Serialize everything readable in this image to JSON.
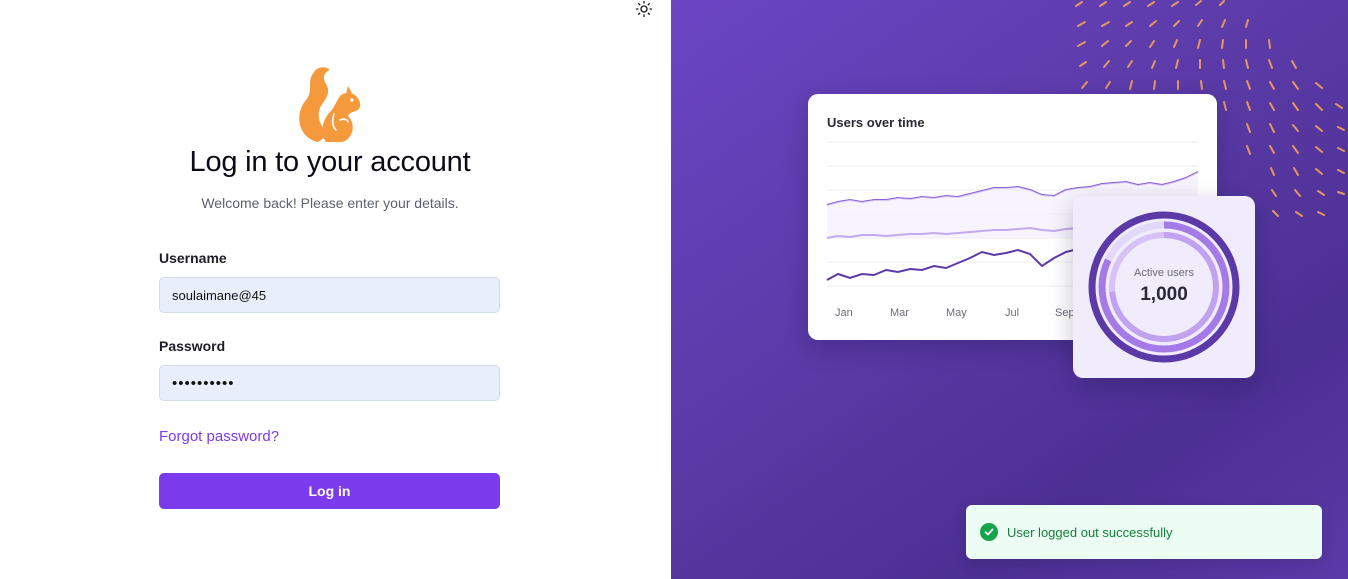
{
  "header": {
    "theme_toggle_icon": "sun-icon"
  },
  "brand": {
    "logo_icon": "squirrel-logo-icon",
    "logo_color": "#f59a3c"
  },
  "login": {
    "title": "Log in to your account",
    "subtitle": "Welcome back! Please enter your details.",
    "username_label": "Username",
    "username_value": "soulaimane@45",
    "password_label": "Password",
    "password_value": "••••••••••",
    "forgot_label": "Forgot password?",
    "submit_label": "Log in",
    "accent_color": "#7c3aed"
  },
  "showcase": {
    "chart_title": "Users over time",
    "months": [
      "Jan",
      "Mar",
      "May",
      "Jul",
      "Sep"
    ],
    "active_users_label": "Active users",
    "active_users_value": "1,000"
  },
  "toast": {
    "icon": "check-circle-icon",
    "message": "User logged out successfully",
    "color": "#16a34a"
  },
  "colors": {
    "panel_bg": "#5a3aa6",
    "dash_accent": "#f5a05a"
  }
}
